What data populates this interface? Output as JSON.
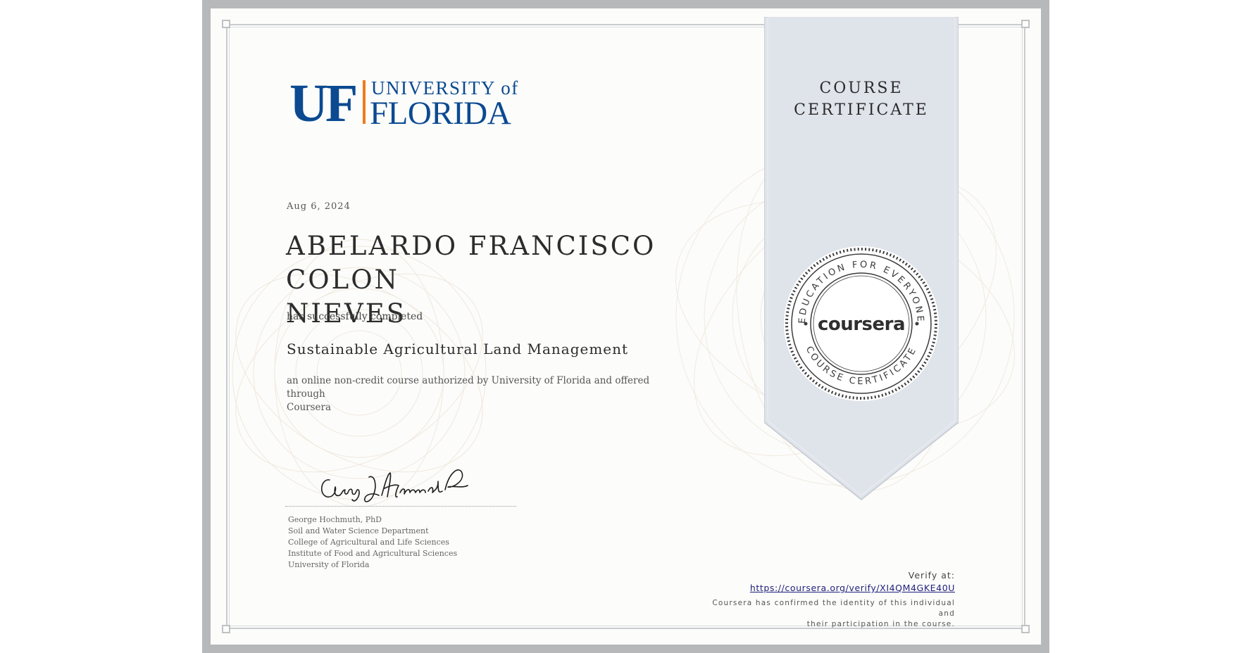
{
  "university": {
    "logo_text_mark": "UF",
    "logo_text_top": "UNIVERSITY of",
    "logo_text_bottom": "FLORIDA"
  },
  "ribbon": {
    "title_line1": "COURSE",
    "title_line2": "CERTIFICATE"
  },
  "seal": {
    "top_arc": "EDUCATION FOR EVERYONE",
    "bottom_arc": "COURSE CERTIFICATE",
    "brand": "coursera"
  },
  "certificate": {
    "date": "Aug 6, 2024",
    "recipient_line1": "ABELARDO FRANCISCO COLON",
    "recipient_line2": "NIEVES",
    "completed_text": "has successfully completed",
    "course_name": "Sustainable Agricultural Land Management",
    "authorized_line1": "an online non-credit course authorized by University of Florida and offered through",
    "authorized_line2": "Coursera"
  },
  "signer": {
    "name": "George Hochmuth, PhD",
    "line2": "Soil and Water Science Department",
    "line3": "College of Agricultural and Life Sciences",
    "line4": "Institute of Food and Agricultural Sciences",
    "line5": "University of Florida"
  },
  "verify": {
    "label": "Verify at:",
    "url": "https://coursera.org/verify/XI4QM4GKE40U",
    "note_line1": "Coursera has confirmed the identity of this individual and",
    "note_line2": "their participation in the course."
  },
  "colors": {
    "uf_blue": "#0b4a91",
    "uf_orange": "#f27a1a",
    "ribbon": "#dfe3ea",
    "frame": "#b6b8ba"
  }
}
